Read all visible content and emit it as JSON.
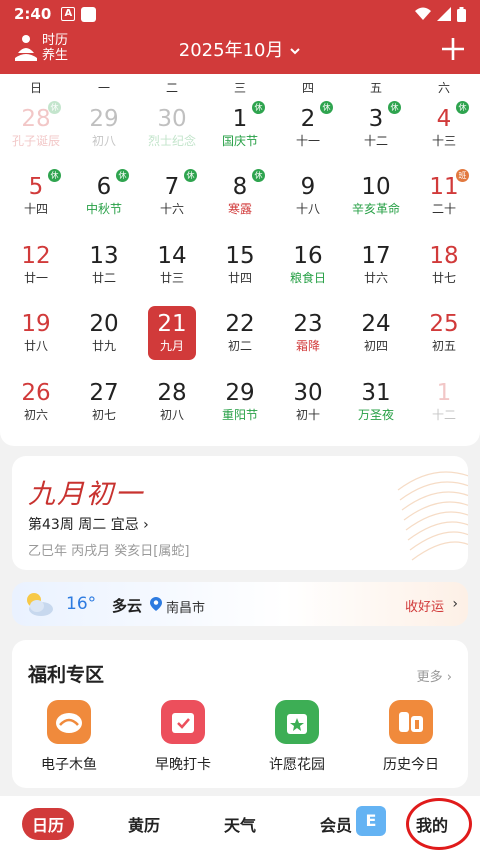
{
  "status": {
    "time": "2:40",
    "a_label": "A"
  },
  "header": {
    "logo_line1": "时历",
    "logo_line2": "养生",
    "month_title": "2025年10月"
  },
  "weekdays": [
    "日",
    "一",
    "二",
    "三",
    "四",
    "五",
    "六"
  ],
  "days": [
    {
      "num": "28",
      "sub": "孔子诞辰",
      "other": true,
      "badge": "休",
      "weekend": true,
      "subColor": "red"
    },
    {
      "num": "29",
      "sub": "初八",
      "other": true
    },
    {
      "num": "30",
      "sub": "烈士纪念",
      "other": true,
      "subColor": "green"
    },
    {
      "num": "1",
      "sub": "国庆节",
      "badge": "休",
      "subColor": "green"
    },
    {
      "num": "2",
      "sub": "十一",
      "badge": "休"
    },
    {
      "num": "3",
      "sub": "十二",
      "badge": "休"
    },
    {
      "num": "4",
      "sub": "十三",
      "badge": "休",
      "weekend": true
    },
    {
      "num": "5",
      "sub": "十四",
      "badge": "休",
      "weekend": true
    },
    {
      "num": "6",
      "sub": "中秋节",
      "badge": "休",
      "subColor": "green"
    },
    {
      "num": "7",
      "sub": "十六",
      "badge": "休"
    },
    {
      "num": "8",
      "sub": "寒露",
      "badge": "休",
      "subColor": "red"
    },
    {
      "num": "9",
      "sub": "十八"
    },
    {
      "num": "10",
      "sub": "辛亥革命",
      "subColor": "green"
    },
    {
      "num": "11",
      "sub": "二十",
      "badge": "班",
      "badgeWork": true,
      "weekend": true
    },
    {
      "num": "12",
      "sub": "廿一",
      "weekend": true
    },
    {
      "num": "13",
      "sub": "廿二"
    },
    {
      "num": "14",
      "sub": "廿三"
    },
    {
      "num": "15",
      "sub": "廿四"
    },
    {
      "num": "16",
      "sub": "粮食日",
      "subColor": "green"
    },
    {
      "num": "17",
      "sub": "廿六"
    },
    {
      "num": "18",
      "sub": "廿七",
      "weekend": true
    },
    {
      "num": "19",
      "sub": "廿八",
      "weekend": true
    },
    {
      "num": "20",
      "sub": "廿九"
    },
    {
      "num": "21",
      "sub": "九月",
      "selected": true
    },
    {
      "num": "22",
      "sub": "初二"
    },
    {
      "num": "23",
      "sub": "霜降",
      "subColor": "red"
    },
    {
      "num": "24",
      "sub": "初四"
    },
    {
      "num": "25",
      "sub": "初五",
      "weekend": true
    },
    {
      "num": "26",
      "sub": "初六",
      "weekend": true
    },
    {
      "num": "27",
      "sub": "初七"
    },
    {
      "num": "28",
      "sub": "初八"
    },
    {
      "num": "29",
      "sub": "重阳节",
      "subColor": "green"
    },
    {
      "num": "30",
      "sub": "初十"
    },
    {
      "num": "31",
      "sub": "万圣夜",
      "subColor": "green"
    },
    {
      "num": "1",
      "sub": "十二",
      "other": true,
      "weekend": true
    }
  ],
  "lunar": {
    "title": "九月初一",
    "week_line": "第43周 周二 宜忌 ›",
    "ganzhi": "乙巳年 丙戌月 癸亥日[属蛇]"
  },
  "weather": {
    "temp": "16°",
    "text": "多云",
    "location": "南昌市",
    "fortune": "收好运",
    "chevron": "›"
  },
  "welfare": {
    "title": "福利专区",
    "more": "更多 ›",
    "items": [
      {
        "label": "电子木鱼",
        "color": "#f08a3c"
      },
      {
        "label": "早晚打卡",
        "color": "#ec4f5c"
      },
      {
        "label": "许愿花园",
        "color": "#3dae55"
      },
      {
        "label": "历史今日",
        "color": "#f08a3c"
      }
    ]
  },
  "tabs": [
    {
      "label": "日历",
      "active": true
    },
    {
      "label": "黄历"
    },
    {
      "label": "天气"
    },
    {
      "label": "会员"
    },
    {
      "label": "我的"
    }
  ]
}
